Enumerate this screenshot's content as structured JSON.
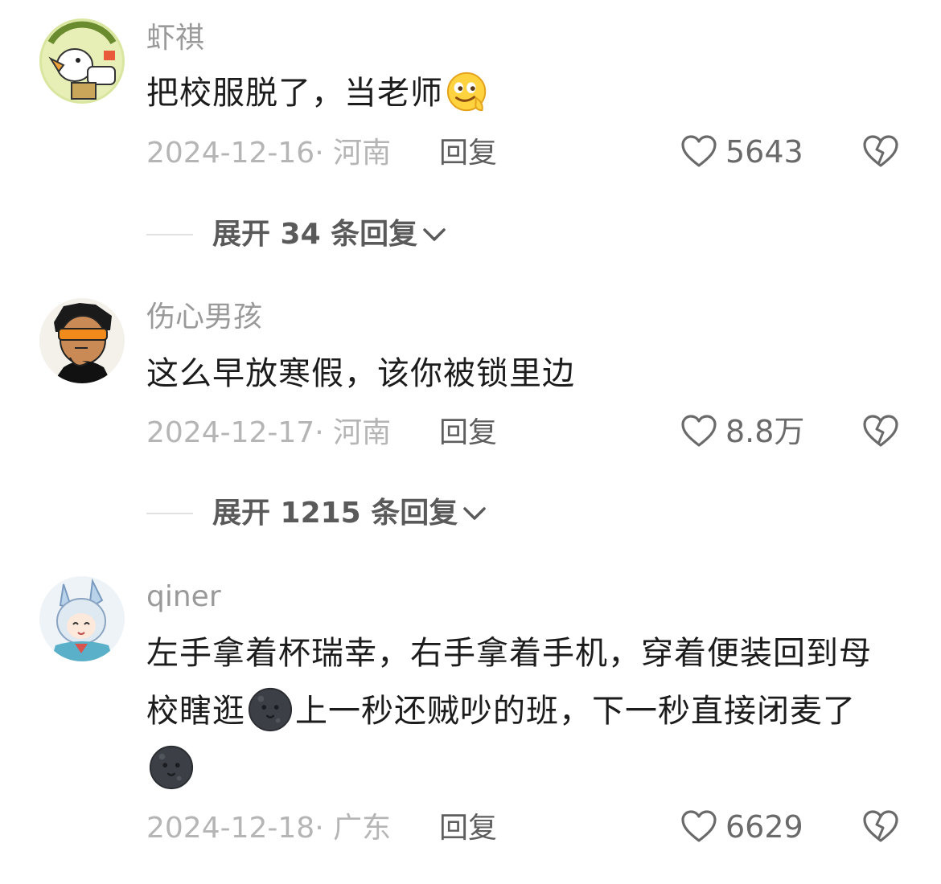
{
  "comments": [
    {
      "username": "虾祺",
      "text_parts": [
        "把校服脱了，当老师"
      ],
      "emoji": "drooling-face",
      "date": "2024-12-16",
      "location": "河南",
      "reply_label": "回复",
      "likes": "5643",
      "expand_label": "展开 34 条回复"
    },
    {
      "username": "伤心男孩",
      "text_parts": [
        "这么早放寒假，该你被锁里边"
      ],
      "date": "2024-12-17",
      "location": "河南",
      "reply_label": "回复",
      "likes": "8.8万",
      "expand_label": "展开 1215 条回复"
    },
    {
      "username": "qiner",
      "text_parts": [
        "左手拿着杯瑞幸，右手拿着手机，穿着便装回到母校瞎逛",
        "上一秒还贼吵的班，下一秒直接闭麦了"
      ],
      "emoji": "new-moon-face",
      "date": "2024-12-18",
      "location": "广东",
      "reply_label": "回复",
      "likes": "6629"
    }
  ],
  "colors": {
    "username": "#9a9a9a",
    "text": "#1c1c1c",
    "meta": "#b5b5b5",
    "reply": "#5e5e5e",
    "expand": "#5a5a5a"
  }
}
